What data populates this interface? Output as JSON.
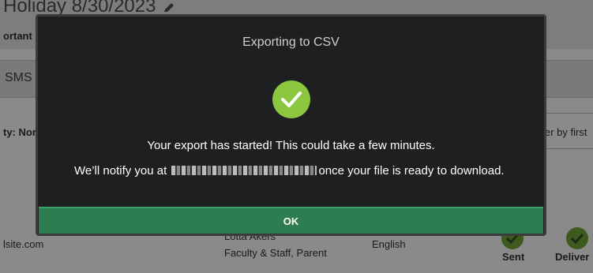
{
  "background": {
    "title": "Holiday 8/30/2023",
    "subtitle": "ortant",
    "tab_label": "SMS",
    "filter_left": "ty: Nor",
    "filter_right": "er by first",
    "row": {
      "email": "lsite.com",
      "name": "Lotta Akers",
      "role": "Faculty & Staff, Parent",
      "language": "English",
      "status_1": "Sent",
      "status_2": "Deliver"
    }
  },
  "modal": {
    "title": "Exporting to CSV",
    "message_1": "Your export has started! This could take a few minutes.",
    "message_2_prefix": "We’ll notify you at ",
    "message_2_suffix": "once your file is ready to download.",
    "ok_label": "OK"
  },
  "colors": {
    "modal_bg": "#1e1f21",
    "success_green": "#8dc63f",
    "ok_button": "#2e7d52"
  },
  "icons": {
    "success": "check-circle-icon",
    "edit": "pencil-icon"
  }
}
